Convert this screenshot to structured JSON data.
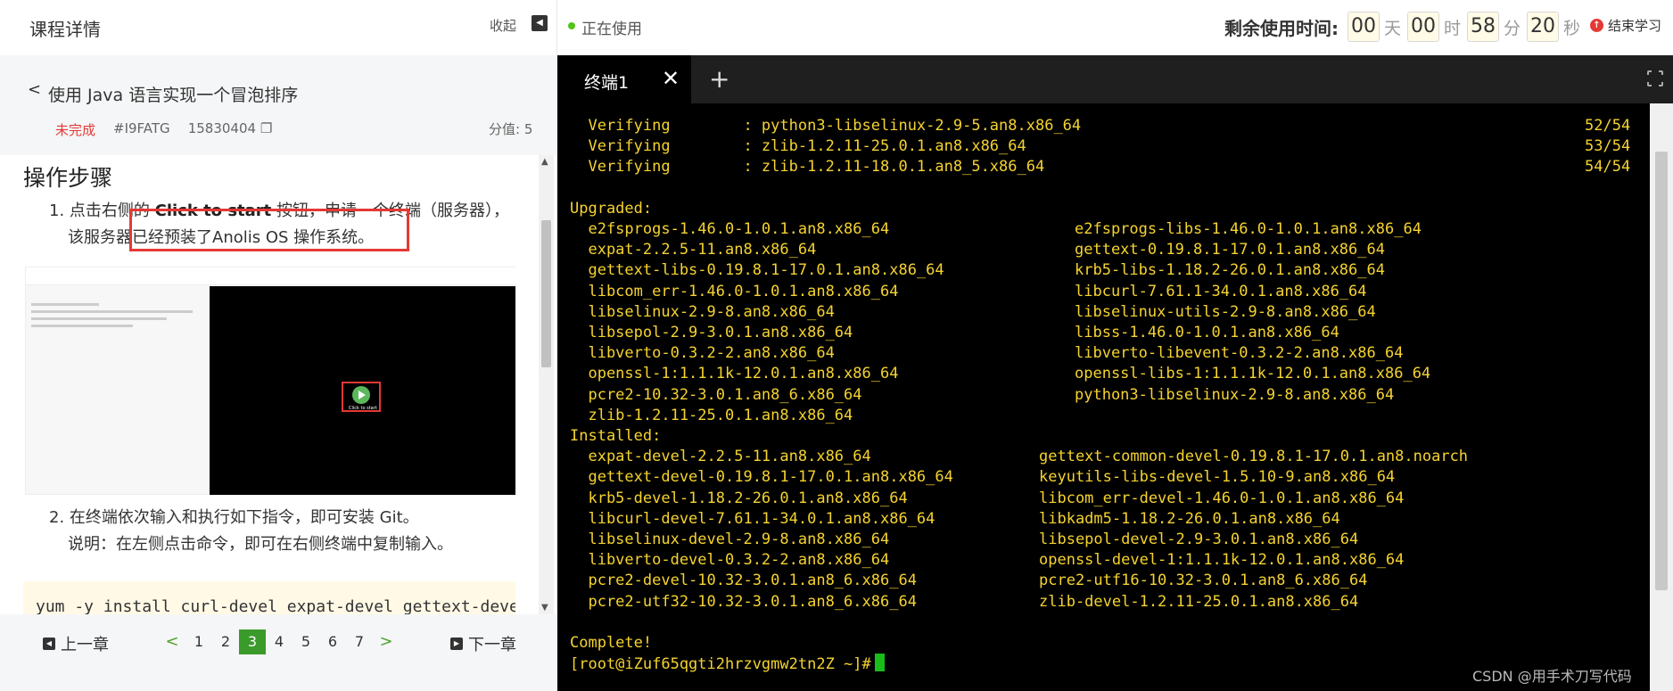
{
  "header": {
    "course_title": "课程详情",
    "collapse_label": "收起",
    "status": "正在使用",
    "timer_label": "剩余使用时间:",
    "timer": [
      {
        "value": "00",
        "unit": "天"
      },
      {
        "value": "00",
        "unit": "时"
      },
      {
        "value": "58",
        "unit": "分"
      },
      {
        "value": "20",
        "unit": "秒"
      }
    ],
    "end_label": "结束学习"
  },
  "lesson": {
    "title": "使用 Java 语言实现一个冒泡排序",
    "status": "未完成",
    "code": "#I9FATG",
    "number": "15830404",
    "score": "分值: 5"
  },
  "content": {
    "steps_title": "操作步骤",
    "step1_pre": "1. 点击右侧的 ",
    "step1_bold": "Click to start",
    "step1_post": " 按钮，申请一个终端（服务器），",
    "step1_line2": "该服务器已经预装了Anolis OS 操作系统。",
    "step2_line1": "2. 在终端依次输入和执行如下指令，即可安装 Git。",
    "step2_line2": "说明：在左侧点击命令，即可在右侧终端中复制输入。",
    "code": "yum -y install curl-devel expat-devel gettext-devel ope",
    "screenshot_caption": "Click to start"
  },
  "pager": {
    "prev": "上一章",
    "next": "下一章",
    "pages": [
      "1",
      "2",
      "3",
      "4",
      "5",
      "6",
      "7"
    ],
    "current": "3"
  },
  "terminal": {
    "tab_label": "终端1",
    "lines": [
      {
        "a": "  Verifying        : python3-libselinux-2.9-5.an8.x86_64",
        "b": "",
        "p": "52/54"
      },
      {
        "a": "  Verifying        : zlib-1.2.11-25.0.1.an8.x86_64",
        "b": "",
        "p": "53/54"
      },
      {
        "a": "  Verifying        : zlib-1.2.11-18.0.1.an8_5.x86_64",
        "b": "",
        "p": "54/54"
      },
      {
        "a": "",
        "b": "",
        "p": ""
      },
      {
        "a": "Upgraded:",
        "b": "",
        "p": ""
      },
      {
        "a": "  e2fsprogs-1.46.0-1.0.1.an8.x86_64",
        "b": "e2fsprogs-libs-1.46.0-1.0.1.an8.x86_64",
        "p": ""
      },
      {
        "a": "  expat-2.2.5-11.an8.x86_64",
        "b": "gettext-0.19.8.1-17.0.1.an8.x86_64",
        "p": ""
      },
      {
        "a": "  gettext-libs-0.19.8.1-17.0.1.an8.x86_64",
        "b": "krb5-libs-1.18.2-26.0.1.an8.x86_64",
        "p": ""
      },
      {
        "a": "  libcom_err-1.46.0-1.0.1.an8.x86_64",
        "b": "libcurl-7.61.1-34.0.1.an8.x86_64",
        "p": ""
      },
      {
        "a": "  libselinux-2.9-8.an8.x86_64",
        "b": "libselinux-utils-2.9-8.an8.x86_64",
        "p": ""
      },
      {
        "a": "  libsepol-2.9-3.0.1.an8.x86_64",
        "b": "libss-1.46.0-1.0.1.an8.x86_64",
        "p": ""
      },
      {
        "a": "  libverto-0.3.2-2.an8.x86_64",
        "b": "libverto-libevent-0.3.2-2.an8.x86_64",
        "p": ""
      },
      {
        "a": "  openssl-1:1.1.1k-12.0.1.an8.x86_64",
        "b": "openssl-libs-1:1.1.1k-12.0.1.an8.x86_64",
        "p": ""
      },
      {
        "a": "  pcre2-10.32-3.0.1.an8_6.x86_64",
        "b": "python3-libselinux-2.9-8.an8.x86_64",
        "p": ""
      },
      {
        "a": "  zlib-1.2.11-25.0.1.an8.x86_64",
        "b": "",
        "p": ""
      },
      {
        "a": "Installed:",
        "b": "",
        "p": ""
      },
      {
        "a": "  expat-devel-2.2.5-11.an8.x86_64",
        "b": "gettext-common-devel-0.19.8.1-17.0.1.an8.noarch",
        "p": ""
      },
      {
        "a": "  gettext-devel-0.19.8.1-17.0.1.an8.x86_64",
        "b": "keyutils-libs-devel-1.5.10-9.an8.x86_64",
        "p": ""
      },
      {
        "a": "  krb5-devel-1.18.2-26.0.1.an8.x86_64",
        "b": "libcom_err-devel-1.46.0-1.0.1.an8.x86_64",
        "p": ""
      },
      {
        "a": "  libcurl-devel-7.61.1-34.0.1.an8.x86_64",
        "b": "libkadm5-1.18.2-26.0.1.an8.x86_64",
        "p": ""
      },
      {
        "a": "  libselinux-devel-2.9-8.an8.x86_64",
        "b": "libsepol-devel-2.9-3.0.1.an8.x86_64",
        "p": ""
      },
      {
        "a": "  libverto-devel-0.3.2-2.an8.x86_64",
        "b": "openssl-devel-1:1.1.1k-12.0.1.an8.x86_64",
        "p": ""
      },
      {
        "a": "  pcre2-devel-10.32-3.0.1.an8_6.x86_64",
        "b": "pcre2-utf16-10.32-3.0.1.an8_6.x86_64",
        "p": ""
      },
      {
        "a": "  pcre2-utf32-10.32-3.0.1.an8_6.x86_64",
        "b": "zlib-devel-1.2.11-25.0.1.an8.x86_64",
        "p": ""
      },
      {
        "a": "",
        "b": "",
        "p": ""
      },
      {
        "a": "Complete!",
        "b": "",
        "p": ""
      }
    ],
    "prompt": "[root@iZuf65qgti2hrzvgmw2tn2Z ~]#"
  },
  "watermark": "CSDN @用手术刀写代码"
}
